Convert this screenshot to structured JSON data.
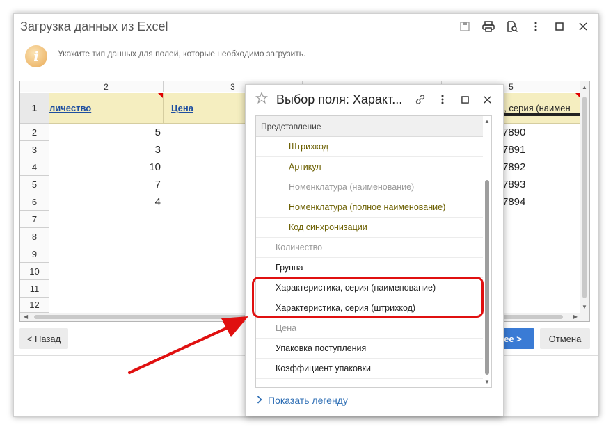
{
  "window": {
    "title": "Загрузка данных из Excel",
    "info_text": "Укажите тип данных для полей, которые необходимо загрузить."
  },
  "icons": {
    "save": "save-icon",
    "print": "print-icon",
    "preview": "preview-icon",
    "more": "more-icon",
    "maximize": "maximize-icon",
    "close": "close-icon",
    "info": "info-icon",
    "star": "star-icon",
    "link": "link-icon",
    "chevron": "chevron-right-icon"
  },
  "sheet": {
    "columns": [
      "2",
      "3",
      "5"
    ],
    "header_row_number": "1",
    "header_cells": {
      "col2": "личество",
      "col3": "Цена",
      "col5": "ка, серия (наимен"
    },
    "row_numbers": [
      "2",
      "3",
      "4",
      "5",
      "6",
      "7",
      "8",
      "9",
      "10",
      "11",
      "12"
    ],
    "qty_values": [
      "5",
      "3",
      "10",
      "7",
      "4"
    ],
    "col5_values": [
      "7890",
      "7891",
      "7892",
      "7893",
      "7894"
    ]
  },
  "buttons": {
    "back": "< Назад",
    "next": "лее >",
    "cancel": "Отмена"
  },
  "popup": {
    "title": "Выбор поля: Характ...",
    "list_header": "Представление",
    "items": [
      {
        "label": "Штрихкод"
      },
      {
        "label": "Артикул"
      },
      {
        "label": "Номенклатура (наименование)"
      },
      {
        "label": "Номенклатура (полное наименование)"
      },
      {
        "label": "Код синхронизации"
      },
      {
        "label": "Количество"
      },
      {
        "label": "Группа"
      },
      {
        "label": "Характеристика, серия (наименование)"
      },
      {
        "label": "Характеристика, серия (штрихкод)"
      },
      {
        "label": "Цена"
      },
      {
        "label": "Упаковка поступления"
      },
      {
        "label": "Коэффициент упаковки"
      }
    ],
    "legend_link": "Показать легенду"
  },
  "colors": {
    "accent_blue": "#3a7bd5",
    "header_yellow": "#f5eec0",
    "highlight_red": "#e01010",
    "link_blue": "#1f4fa0",
    "olive_text": "#6b5f00"
  }
}
